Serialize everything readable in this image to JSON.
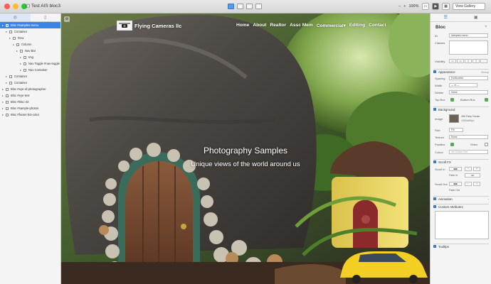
{
  "window": {
    "title": "Test AIS bloc3"
  },
  "toolbar": {
    "zoom": "100%",
    "device_select": "View Gallery"
  },
  "left_panel": {
    "tree": [
      {
        "label": "Bloc #samples-menu",
        "indent": 0,
        "selected": true
      },
      {
        "label": "Container",
        "indent": 1,
        "selected": false
      },
      {
        "label": "Row",
        "indent": 2,
        "selected": false
      },
      {
        "label": "Column",
        "indent": 3,
        "selected": false
      },
      {
        "label": "Nav Bar",
        "indent": 4,
        "selected": false
      },
      {
        "label": "Img",
        "indent": 5,
        "selected": false
      },
      {
        "label": "Nav Toggle #nav-toggle",
        "indent": 5,
        "selected": false
      },
      {
        "label": "Nav Container",
        "indent": 5,
        "selected": false
      },
      {
        "label": "Container",
        "indent": 1,
        "selected": false
      },
      {
        "label": "Container",
        "indent": 1,
        "selected": false
      },
      {
        "label": "Bloc #eye-of-photographer",
        "indent": 0,
        "selected": false
      },
      {
        "label": "Bloc #eye-text",
        "indent": 0,
        "selected": false
      },
      {
        "label": "Bloc #bloc-43",
        "indent": 0,
        "selected": false
      },
      {
        "label": "Bloc #sample-photos",
        "indent": 0,
        "selected": false
      },
      {
        "label": "Bloc #footer-bot-color",
        "indent": 0,
        "selected": false
      }
    ]
  },
  "canvas": {
    "brand": "Flying Cameras llc",
    "nav": [
      "Home",
      "About",
      "Realtor",
      "Assc Mem",
      "Commercial",
      "Editing",
      "Contact"
    ],
    "commercial_caret": "▾",
    "hero_title": "Photography Samples",
    "hero_subtitle": "Unique views of the world around us"
  },
  "right_panel": {
    "title": "Bloc",
    "id_label": "ID",
    "id_value": "samples-menu",
    "classes_label": "Classes",
    "visibility_label": "Visibility",
    "appearance": {
      "header": "Appearance",
      "header_more": "Group",
      "spacing_label": "Spacing",
      "spacing_value": "FullScreen",
      "width_label": "Width",
      "divider_label": "Divider",
      "divider_value": "None",
      "top_box_label": "Top Box",
      "bottom_box_label": "Bottom Box"
    },
    "background": {
      "header": "Background",
      "image_label": "Image",
      "image_name": "366 Fairy House",
      "image_size": "1000x666px",
      "size_label": "Size",
      "size_value": "Fill",
      "texture_label": "Texture",
      "texture_value": "None",
      "parallax_label": "Parallax",
      "video_label": "Video",
      "colour_label": "Colour",
      "colour_value": "No Colour Set"
    },
    "scroll_fx": {
      "header": "Scroll FX",
      "scroll_in_label": "Scroll In",
      "fade_in": "Fade In",
      "scroll_out_label": "Scroll Out",
      "fade_out": "Fade Out"
    },
    "sections": [
      "Animation",
      "Custom Attributes",
      "Tooltips"
    ]
  }
}
